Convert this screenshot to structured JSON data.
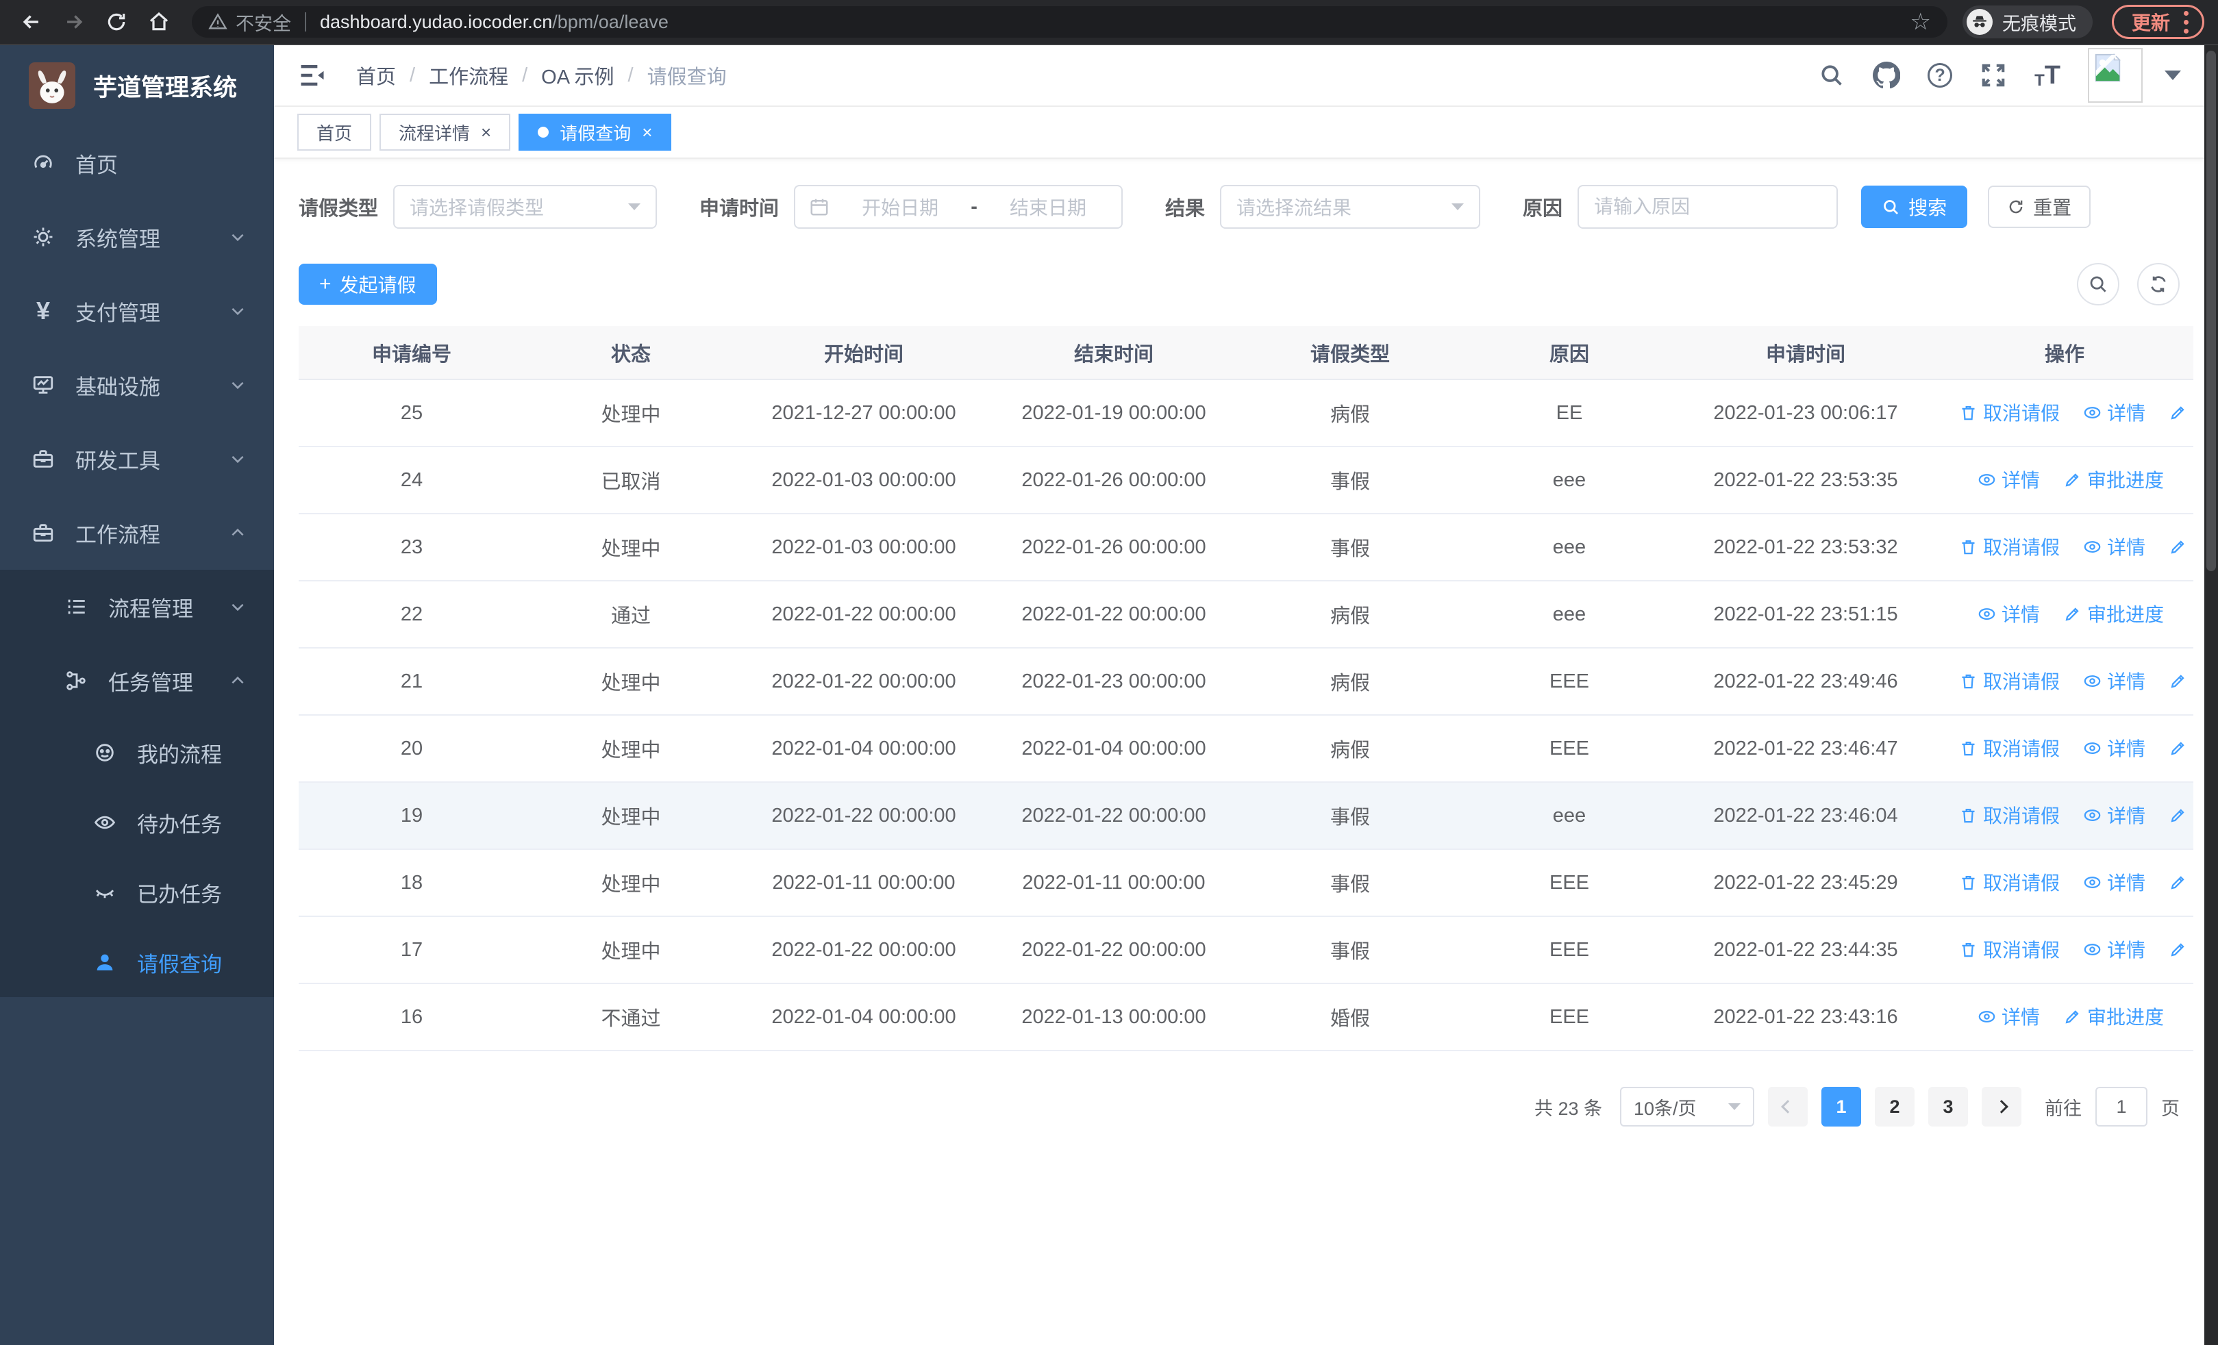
{
  "browser": {
    "security_label": "不安全",
    "url_host": "dashboard.yudao.iocoder.cn",
    "url_path": "/bpm/oa/leave",
    "incognito_label": "无痕模式",
    "update_label": "更新"
  },
  "sidebar": {
    "logo_title": "芋道管理系统",
    "items": [
      {
        "label": "首页",
        "icon": "dashboard-icon",
        "level": 1,
        "expandable": false,
        "expanded": false,
        "active": false
      },
      {
        "label": "系统管理",
        "icon": "gear-icon",
        "level": 1,
        "expandable": true,
        "expanded": false,
        "active": false
      },
      {
        "label": "支付管理",
        "icon": "yen-icon",
        "level": 1,
        "expandable": true,
        "expanded": false,
        "active": false
      },
      {
        "label": "基础设施",
        "icon": "monitor-icon",
        "level": 1,
        "expandable": true,
        "expanded": false,
        "active": false
      },
      {
        "label": "研发工具",
        "icon": "toolbox-icon",
        "level": 1,
        "expandable": true,
        "expanded": false,
        "active": false
      },
      {
        "label": "工作流程",
        "icon": "briefcase-icon",
        "level": 1,
        "expandable": true,
        "expanded": true,
        "active": false
      },
      {
        "label": "流程管理",
        "icon": "list-icon",
        "level": 2,
        "expandable": true,
        "expanded": false,
        "active": false
      },
      {
        "label": "任务管理",
        "icon": "sitemap-icon",
        "level": 2,
        "expandable": true,
        "expanded": true,
        "active": false
      },
      {
        "label": "我的流程",
        "icon": "face-icon",
        "level": 3,
        "expandable": false,
        "expanded": false,
        "active": false
      },
      {
        "label": "待办任务",
        "icon": "eye-icon",
        "level": 3,
        "expandable": false,
        "expanded": false,
        "active": false
      },
      {
        "label": "已办任务",
        "icon": "eye-closed-icon",
        "level": 3,
        "expandable": false,
        "expanded": false,
        "active": false
      },
      {
        "label": "请假查询",
        "icon": "user-icon",
        "level": 3,
        "expandable": false,
        "expanded": false,
        "active": true
      }
    ]
  },
  "header": {
    "breadcrumb": [
      "首页",
      "工作流程",
      "OA 示例",
      "请假查询"
    ]
  },
  "tabs": [
    {
      "label": "首页",
      "closable": false,
      "active": false
    },
    {
      "label": "流程详情",
      "closable": true,
      "active": false
    },
    {
      "label": "请假查询",
      "closable": true,
      "active": true
    }
  ],
  "filters": {
    "leave_type_label": "请假类型",
    "leave_type_placeholder": "请选择请假类型",
    "apply_time_label": "申请时间",
    "date_start_placeholder": "开始日期",
    "date_separator": "-",
    "date_end_placeholder": "结束日期",
    "result_label": "结果",
    "result_placeholder": "请选择流结果",
    "reason_label": "原因",
    "reason_placeholder": "请输入原因",
    "search_label": "搜索",
    "reset_label": "重置"
  },
  "toolbar": {
    "create_label": "发起请假"
  },
  "actions_labels": {
    "cancel": "取消请假",
    "detail": "详情",
    "progress": "审批进度"
  },
  "table": {
    "columns": [
      "申请编号",
      "状态",
      "开始时间",
      "结束时间",
      "请假类型",
      "原因",
      "申请时间",
      "操作"
    ],
    "rows": [
      {
        "id": "25",
        "status": "处理中",
        "start": "2021-12-27 00:00:00",
        "end": "2022-01-19 00:00:00",
        "type": "病假",
        "reason": "EE",
        "apply_time": "2022-01-23 00:06:17",
        "actions": [
          "cancel",
          "detail",
          "progress"
        ],
        "highlight": false
      },
      {
        "id": "24",
        "status": "已取消",
        "start": "2022-01-03 00:00:00",
        "end": "2022-01-26 00:00:00",
        "type": "事假",
        "reason": "eee",
        "apply_time": "2022-01-22 23:53:35",
        "actions": [
          "detail",
          "progress"
        ],
        "highlight": false
      },
      {
        "id": "23",
        "status": "处理中",
        "start": "2022-01-03 00:00:00",
        "end": "2022-01-26 00:00:00",
        "type": "事假",
        "reason": "eee",
        "apply_time": "2022-01-22 23:53:32",
        "actions": [
          "cancel",
          "detail",
          "progress"
        ],
        "highlight": false
      },
      {
        "id": "22",
        "status": "通过",
        "start": "2022-01-22 00:00:00",
        "end": "2022-01-22 00:00:00",
        "type": "病假",
        "reason": "eee",
        "apply_time": "2022-01-22 23:51:15",
        "actions": [
          "detail",
          "progress"
        ],
        "highlight": false
      },
      {
        "id": "21",
        "status": "处理中",
        "start": "2022-01-22 00:00:00",
        "end": "2022-01-23 00:00:00",
        "type": "病假",
        "reason": "EEE",
        "apply_time": "2022-01-22 23:49:46",
        "actions": [
          "cancel",
          "detail",
          "progress"
        ],
        "highlight": false
      },
      {
        "id": "20",
        "status": "处理中",
        "start": "2022-01-04 00:00:00",
        "end": "2022-01-04 00:00:00",
        "type": "病假",
        "reason": "EEE",
        "apply_time": "2022-01-22 23:46:47",
        "actions": [
          "cancel",
          "detail",
          "progress"
        ],
        "highlight": false
      },
      {
        "id": "19",
        "status": "处理中",
        "start": "2022-01-22 00:00:00",
        "end": "2022-01-22 00:00:00",
        "type": "事假",
        "reason": "eee",
        "apply_time": "2022-01-22 23:46:04",
        "actions": [
          "cancel",
          "detail",
          "progress"
        ],
        "highlight": true
      },
      {
        "id": "18",
        "status": "处理中",
        "start": "2022-01-11 00:00:00",
        "end": "2022-01-11 00:00:00",
        "type": "事假",
        "reason": "EEE",
        "apply_time": "2022-01-22 23:45:29",
        "actions": [
          "cancel",
          "detail",
          "progress"
        ],
        "highlight": false
      },
      {
        "id": "17",
        "status": "处理中",
        "start": "2022-01-22 00:00:00",
        "end": "2022-01-22 00:00:00",
        "type": "事假",
        "reason": "EEE",
        "apply_time": "2022-01-22 23:44:35",
        "actions": [
          "cancel",
          "detail",
          "progress"
        ],
        "highlight": false
      },
      {
        "id": "16",
        "status": "不通过",
        "start": "2022-01-04 00:00:00",
        "end": "2022-01-13 00:00:00",
        "type": "婚假",
        "reason": "EEE",
        "apply_time": "2022-01-22 23:43:16",
        "actions": [
          "detail",
          "progress"
        ],
        "highlight": false
      }
    ]
  },
  "pagination": {
    "total_label": "共 23 条",
    "page_size": "10条/页",
    "pages": [
      "1",
      "2",
      "3"
    ],
    "active_page": "1",
    "goto_label": "前往",
    "goto_value": "1",
    "page_suffix": "页"
  },
  "colors": {
    "primary": "#409eff",
    "sidebar_bg": "#304156",
    "submenu_bg": "#263445",
    "header_bg": "#f8f8f9"
  }
}
